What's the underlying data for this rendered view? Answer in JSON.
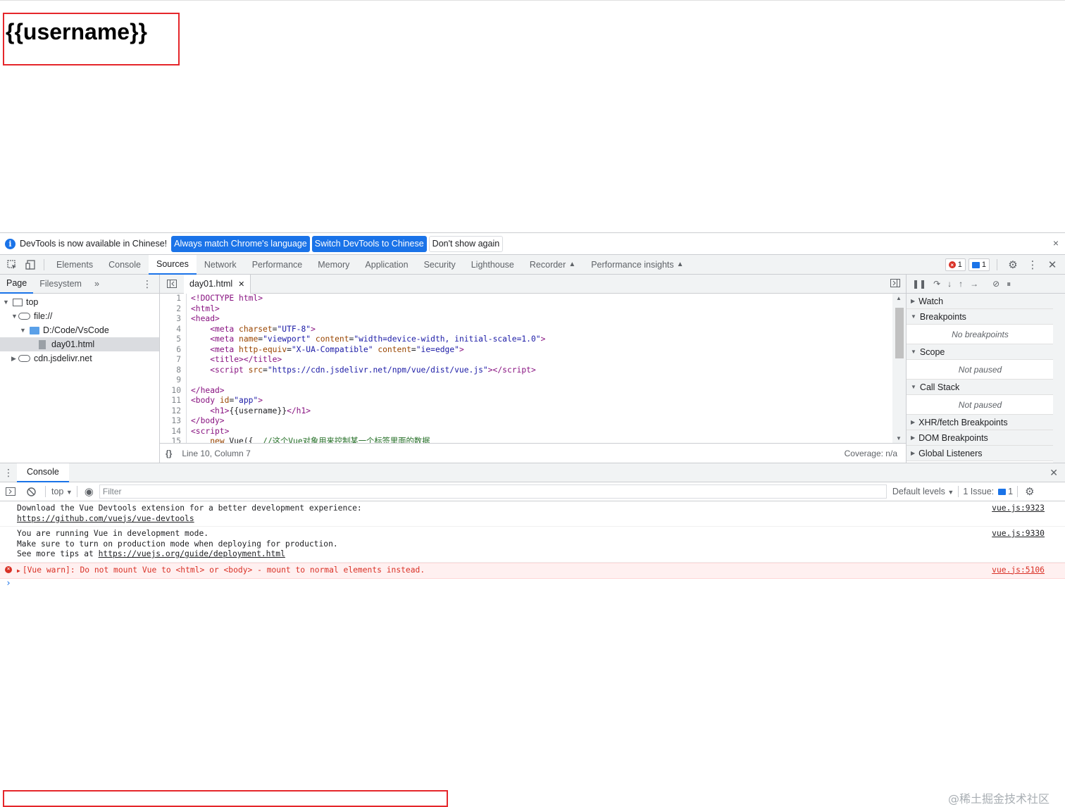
{
  "page": {
    "heading": "{{username}}"
  },
  "infobar": {
    "text": "DevTools is now available in Chinese!",
    "btn_match": "Always match Chrome's language",
    "btn_switch": "Switch DevTools to Chinese",
    "btn_dont_show": "Don't show again",
    "close": "×"
  },
  "tabs": [
    "Elements",
    "Console",
    "Sources",
    "Network",
    "Performance",
    "Memory",
    "Application",
    "Security",
    "Lighthouse",
    "Recorder",
    "Performance insights"
  ],
  "badges": {
    "errors": "1",
    "messages": "1"
  },
  "navigator": {
    "tabs": [
      "Page",
      "Filesystem"
    ],
    "more": "»",
    "tree": [
      {
        "label": "top"
      },
      {
        "label": "file://"
      },
      {
        "label": "D:/Code/VsCode"
      },
      {
        "label": "day01.html"
      },
      {
        "label": "cdn.jsdelivr.net"
      }
    ]
  },
  "editor": {
    "file_tab": "day01.html",
    "status_pos": "Line 10, Column 7",
    "coverage": "Coverage: n/a",
    "lines": [
      {
        "n": "1",
        "html": "<span class=\"tag\">&lt;!DOCTYPE html&gt;</span>"
      },
      {
        "n": "2",
        "html": "<span class=\"tag\">&lt;html&gt;</span>"
      },
      {
        "n": "3",
        "html": "<span class=\"tag\">&lt;head&gt;</span>"
      },
      {
        "n": "4",
        "html": "    <span class=\"tag\">&lt;meta</span> <span class=\"attr\">charset</span>=<span class=\"val\">\"UTF-8\"</span><span class=\"tag\">&gt;</span>"
      },
      {
        "n": "5",
        "html": "    <span class=\"tag\">&lt;meta</span> <span class=\"attr\">name</span>=<span class=\"val\">\"viewport\"</span> <span class=\"attr\">content</span>=<span class=\"val\">\"width=device-width, initial-scale=1.0\"</span><span class=\"tag\">&gt;</span>"
      },
      {
        "n": "6",
        "html": "    <span class=\"tag\">&lt;meta</span> <span class=\"attr\">http-equiv</span>=<span class=\"val\">\"X-UA-Compatible\"</span> <span class=\"attr\">content</span>=<span class=\"val\">\"ie=edge\"</span><span class=\"tag\">&gt;</span>"
      },
      {
        "n": "7",
        "html": "    <span class=\"tag\">&lt;title&gt;&lt;/title&gt;</span>"
      },
      {
        "n": "8",
        "html": "    <span class=\"tag\">&lt;script</span> <span class=\"attr\">src</span>=<span class=\"val\">\"https://cdn.jsdelivr.net/npm/vue/dist/vue.js\"</span><span class=\"tag\">&gt;&lt;/script&gt;</span>"
      },
      {
        "n": "9",
        "html": ""
      },
      {
        "n": "10",
        "html": "<span class=\"tag\">&lt;/head&gt;</span>"
      },
      {
        "n": "11",
        "html": "<span class=\"tag\">&lt;body</span> <span class=\"attr\">id</span>=<span class=\"val\">\"app\"</span><span class=\"tag\">&gt;</span>"
      },
      {
        "n": "12",
        "html": "    <span class=\"tag\">&lt;h1&gt;</span>{{username}}<span class=\"tag\">&lt;/h1&gt;</span>"
      },
      {
        "n": "13",
        "html": "<span class=\"tag\">&lt;/body&gt;</span>"
      },
      {
        "n": "14",
        "html": "<span class=\"tag\">&lt;script&gt;</span>"
      },
      {
        "n": "15",
        "html": "    <span class=\"attr\">new</span> Vue({  <span class=\"cmt\">//这个Vue对象用来控制某一个标签里面的数据</span>"
      }
    ]
  },
  "debugger": {
    "sections": [
      {
        "title": "Watch",
        "open": false,
        "body": ""
      },
      {
        "title": "Breakpoints",
        "open": true,
        "body": "No breakpoints"
      },
      {
        "title": "Scope",
        "open": true,
        "body": "Not paused"
      },
      {
        "title": "Call Stack",
        "open": true,
        "body": "Not paused"
      },
      {
        "title": "XHR/fetch Breakpoints",
        "open": false,
        "body": ""
      },
      {
        "title": "DOM Breakpoints",
        "open": false,
        "body": ""
      },
      {
        "title": "Global Listeners",
        "open": false,
        "body": ""
      }
    ]
  },
  "drawer": {
    "tab": "Console",
    "context": "top",
    "filter_placeholder": "Filter",
    "levels": "Default levels",
    "issues_label": "1 Issue:",
    "issues_count": "1"
  },
  "console": {
    "msg1_line1": "Download the Vue Devtools extension for a better development experience:",
    "msg1_link": "https://github.com/vuejs/vue-devtools",
    "msg1_src": "vue.js:9323",
    "msg2_line1": "You are running Vue in development mode.",
    "msg2_line2": "Make sure to turn on production mode when deploying for production.",
    "msg2_line3": "See more tips at ",
    "msg2_link": "https://vuejs.org/guide/deployment.html",
    "msg2_src": "vue.js:9330",
    "error_text": "[Vue warn]: Do not mount Vue to <html> or <body> - mount to normal elements instead.",
    "error_src": "vue.js:5106",
    "prompt": "›"
  },
  "watermark": "@稀土掘金技术社区",
  "colors": {
    "accent": "#1a73e8",
    "error": "#d93025",
    "highlight_box": "#e5262b"
  }
}
